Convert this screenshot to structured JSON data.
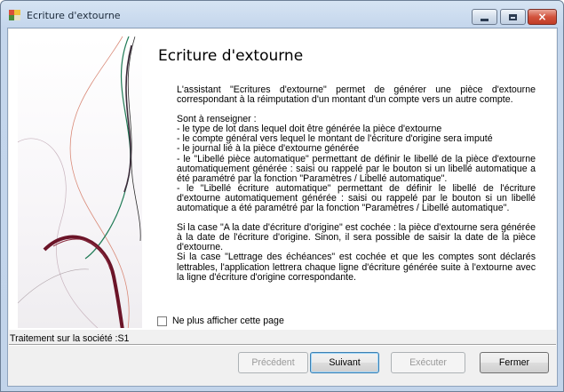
{
  "window": {
    "title": "Ecriture d'extourne",
    "icon": "app-multicolor-icon"
  },
  "title_controls": {
    "minimize": "minimize-icon",
    "maximize": "maximize-icon",
    "close": "×"
  },
  "page": {
    "heading": "Ecriture d'extourne",
    "paragraphs": [
      "L'assistant \"Ecritures d'extourne\" permet de générer une pièce d'extourne correspondant à la réimputation d'un montant d'un compte vers un autre compte."
    ],
    "list_intro": "Sont à renseigner :",
    "list_items": [
      "- le type de lot dans lequel doit être générée la pièce d'extourne",
      "- le compte général vers lequel le montant de l'écriture d'origine sera imputé",
      "- le journal lié à la pièce d'extourne générée",
      "- le \"Libellé pièce automatique\" permettant de définir le libellé de la pièce d'extourne automatiquement générée : saisi ou rappelé par le bouton si un libellé automatique a été paramétré par la fonction \"Paramètres / Libellé automatique\".",
      "- le \"Libellé écriture automatique\" permettant de définir le libellé de l'écriture d'extourne automatiquement générée : saisi ou rappelé par le bouton si un libellé automatique a été paramétré par la fonction \"Paramètres / Libellé automatique\"."
    ],
    "notes": [
      "Si la case \"A la date d'écriture d'origine\" est cochée : la pièce d'extourne sera générée à la date de l'écriture d'origine. Sinon, il sera possible de saisir la date de la pièce d'extourne.",
      "Si la case \"Lettrage des échéances\" est cochée et que les comptes sont déclarés lettrables, l'application lettrera chaque ligne d'écriture générée suite à l'extourne avec la ligne d'écriture d'origine correspondante."
    ],
    "checkbox_label": "Ne plus afficher cette page",
    "checkbox_checked": false
  },
  "status": {
    "text": "Traitement sur la société :S1"
  },
  "buttons": {
    "previous": "Précédent",
    "next": "Suivant",
    "execute": "Exécuter",
    "close": "Fermer"
  },
  "colors": {
    "accent_dark": "#6b1428",
    "accent_green": "#1e7a55",
    "line_light": "#d98a78"
  }
}
